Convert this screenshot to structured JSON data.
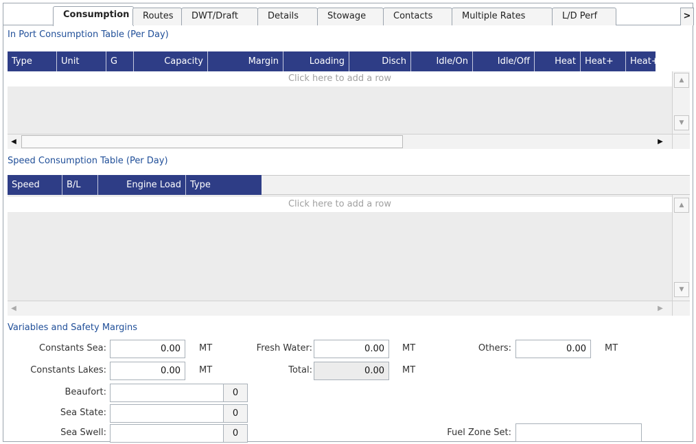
{
  "tabs": [
    {
      "label": "Consumption",
      "active": true
    },
    {
      "label": "Routes"
    },
    {
      "label": "DWT/Draft"
    },
    {
      "label": "Details"
    },
    {
      "label": "Stowage"
    },
    {
      "label": "Contacts"
    },
    {
      "label": "Multiple Rates"
    },
    {
      "label": "L/D Perf"
    }
  ],
  "tab_scroll_label": ">",
  "in_port": {
    "title": "In Port Consumption Table (Per Day)",
    "columns": [
      "Type",
      "Unit",
      "G",
      "Capacity",
      "Margin",
      "Loading",
      "Disch",
      "Idle/On",
      "Idle/Off",
      "Heat",
      "Heat+",
      "Heat+"
    ],
    "add_row_text": "Click here to add a row"
  },
  "speed": {
    "title": "Speed Consumption Table (Per Day)",
    "columns": [
      "Speed",
      "B/L",
      "Engine Load",
      "Type"
    ],
    "add_row_text": "Click here to add a row"
  },
  "variables": {
    "title": "Variables and Safety Margins",
    "constants_sea": {
      "label": "Constants Sea:",
      "value": "0.00",
      "unit": "MT"
    },
    "constants_lakes": {
      "label": "Constants Lakes:",
      "value": "0.00",
      "unit": "MT"
    },
    "fresh_water": {
      "label": "Fresh Water:",
      "value": "0.00",
      "unit": "MT"
    },
    "total": {
      "label": "Total:",
      "value": "0.00",
      "unit": "MT"
    },
    "others": {
      "label": "Others:",
      "value": "0.00",
      "unit": "MT"
    },
    "beaufort": {
      "label": "Beaufort:",
      "value": "",
      "number": "0"
    },
    "sea_state": {
      "label": "Sea State:",
      "value": "",
      "number": "0"
    },
    "sea_swell": {
      "label": "Sea Swell:",
      "value": "",
      "number": "0"
    },
    "fuel_zone_set": {
      "label": "Fuel Zone Set:",
      "value": ""
    }
  },
  "colors": {
    "header_bg": "#2e3d86",
    "section_title": "#1f4e98"
  }
}
